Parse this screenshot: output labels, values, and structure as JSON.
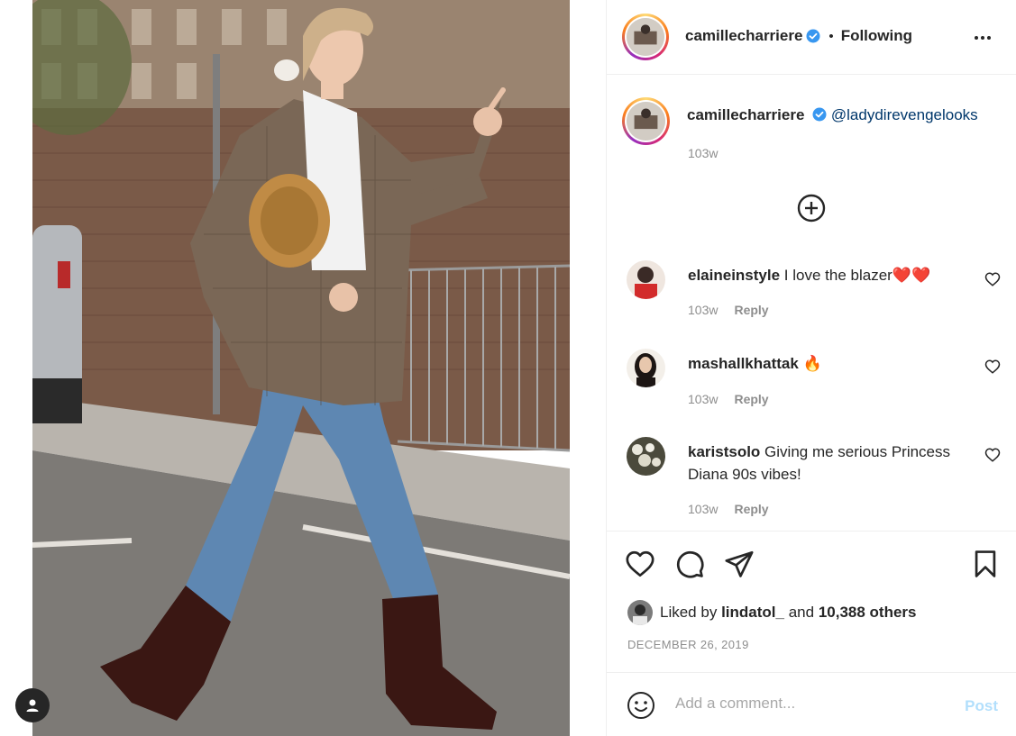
{
  "post": {
    "author": "camillecharriere",
    "follow_state": "Following",
    "separator": "•",
    "caption_mention": "@ladydirevengelooks",
    "caption_time": "103w"
  },
  "comments": [
    {
      "user": "elaineinstyle",
      "text": "I love the blazer❤️❤️",
      "time": "103w",
      "reply": "Reply"
    },
    {
      "user": "mashallkhattak",
      "text": "🔥",
      "time": "103w",
      "reply": "Reply"
    },
    {
      "user": "karistsolo",
      "text": "Giving me serious Princess Diana 90s vibes!",
      "time": "103w",
      "reply": "Reply"
    }
  ],
  "likes": {
    "prefix": "Liked by",
    "user": "lindatol_",
    "conjunction": "and",
    "others": "10,388 others"
  },
  "date": "DECEMBER 26, 2019",
  "composer": {
    "placeholder": "Add a comment...",
    "post_label": "Post"
  },
  "icons": {
    "verified": "verified-badge-icon",
    "more": "more-options-icon",
    "load_more": "plus-circle-icon",
    "like": "heart-icon",
    "comment": "comment-bubble-icon",
    "share": "paper-plane-icon",
    "save": "bookmark-icon",
    "emoji": "smiley-icon",
    "user_tag": "person-icon"
  },
  "colors": {
    "verified_blue": "#3897f0",
    "mention_blue": "#00376b",
    "post_disabled": "#b2dffc",
    "secondary_text": "#8e8e8e"
  }
}
